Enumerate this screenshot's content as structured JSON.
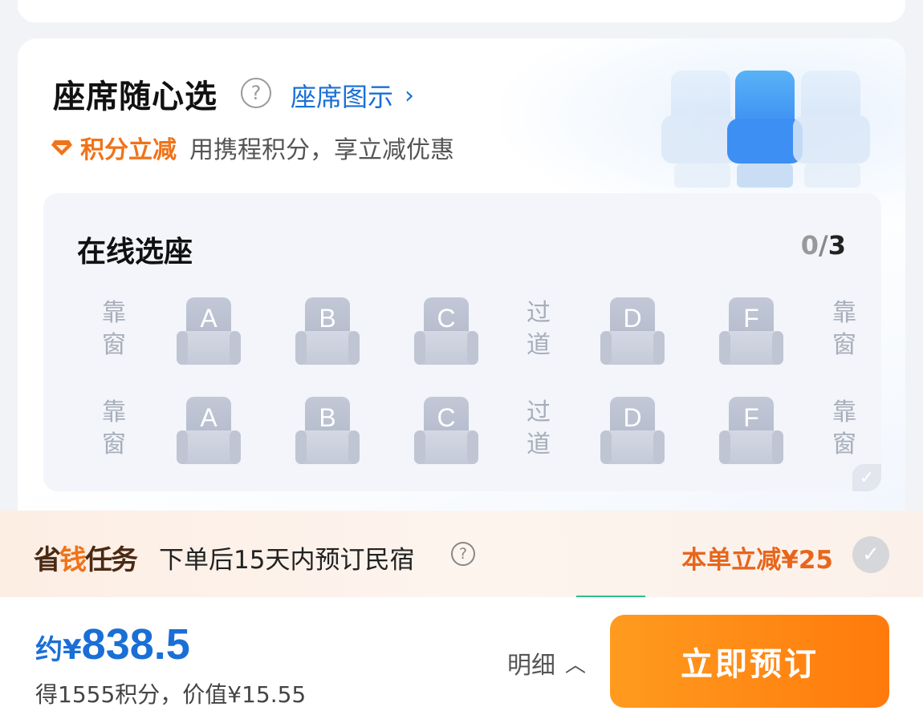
{
  "seat_section": {
    "title": "座席随心选",
    "help_icon": "?",
    "legend_link": "座席图示",
    "legend_chevron": "›",
    "points_tag": "积分立减",
    "points_desc": "用携程积分，享立减优惠"
  },
  "online_select": {
    "title": "在线选座",
    "count_selected": "0",
    "count_sep": "/",
    "count_total": "3",
    "window_label": "靠窗",
    "aisle_label": "过道",
    "rows": [
      {
        "seats": [
          "A",
          "B",
          "C",
          "D",
          "F"
        ]
      },
      {
        "seats": [
          "A",
          "B",
          "C",
          "D",
          "F"
        ]
      }
    ],
    "check_icon": "✓"
  },
  "savings_task": {
    "logo_prefix": "省",
    "logo_accent": "钱",
    "logo_suffix": "任务",
    "text": "下单后15天内预订民宿",
    "help_icon": "?",
    "discount": "本单立减¥25",
    "check_icon": "✓"
  },
  "bottom_bar": {
    "price_prefix": "约",
    "currency": "¥",
    "price": "838.5",
    "points_earn": "得1555积分，价值¥15.55",
    "detail_label": "明细",
    "detail_chevron": "︿",
    "book_label": "立即预订"
  },
  "colors": {
    "accent_blue": "#1a6fd6",
    "accent_orange": "#f07319",
    "book_button": "#ff8a14",
    "seat_gray": "#c2c8d6"
  },
  "icons": [
    "help-icon",
    "diamond-icon",
    "chevron-right-icon",
    "seat-icon",
    "check-icon",
    "chevron-up-icon"
  ]
}
